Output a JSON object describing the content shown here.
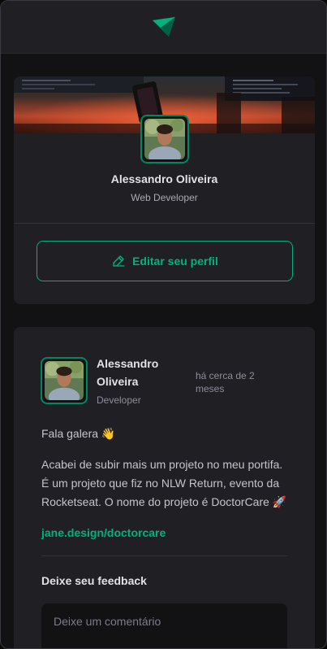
{
  "header": {
    "logo_icon": "ignite-logo-icon"
  },
  "profile": {
    "name": "Alessandro Oliveira",
    "role": "Web Developer",
    "edit_button_label": "Editar seu perfil",
    "edit_icon": "pencil-line-icon"
  },
  "post": {
    "author_name": "Alessandro Oliveira",
    "author_role": "Developer",
    "published": "há cerca de 2 meses",
    "paragraphs": [
      "Fala galera 👋",
      "Acabei de subir mais um projeto no meu portifa. É um projeto que fiz no NLW Return, evento da Rocketseat. O nome do projeto é DoctorCare 🚀"
    ],
    "link": "jane.design/doctorcare",
    "feedback_title": "Deixe seu feedback",
    "comment_placeholder": "Deixe um comentário"
  },
  "colors": {
    "accent": "#00b37e",
    "accent_dark": "#00875f",
    "card": "#202024",
    "background": "#121214"
  }
}
